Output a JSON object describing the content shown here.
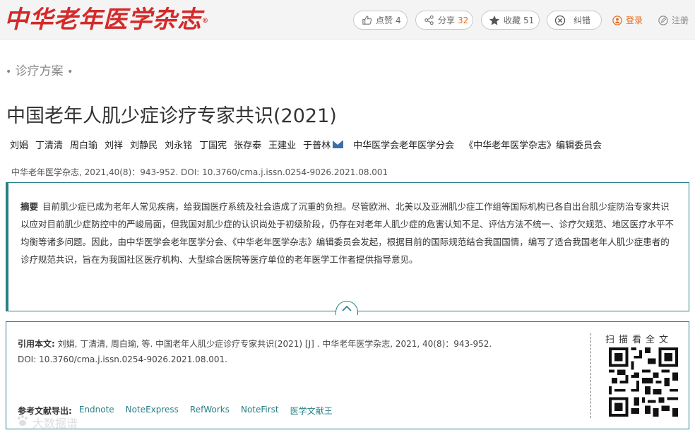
{
  "header": {
    "logo_text": "中华老年医学杂志",
    "logo_mark": "®",
    "like_label": "点赞",
    "like_count": "4",
    "share_label": "分享",
    "share_count": "32",
    "fav_label": "收藏",
    "fav_count": "51",
    "error_label": "纠错",
    "login_label": "登录",
    "register_label": "注册"
  },
  "article": {
    "section_dot": "•",
    "section": "诊疗方案",
    "title": "中国老年人肌少症诊疗专家共识(2021)",
    "authors": [
      "刘娟",
      "丁清清",
      "周白瑜",
      "刘祥",
      "刘静民",
      "刘永铭",
      "丁国宪",
      "张存泰",
      "王建业",
      "于普林"
    ],
    "orgs": [
      "中华医学会老年医学分会",
      "《中华老年医学杂志》编辑委员会"
    ],
    "citation_line": "中华老年医学杂志, 2021,40(8)：943-952. DOI: 10.3760/cma.j.issn.0254-9026.2021.08.001"
  },
  "abstract": {
    "label": "摘要",
    "text": "目前肌少症已成为老年人常见疾病，给我国医疗系统及社会造成了沉重的负担。尽管欧洲、北美以及亚洲肌少症工作组等国际机构已各自出台肌少症防治专家共识以应对目前肌少症防控中的严峻局面，但我国对肌少症的认识尚处于初级阶段，仍存在对老年人肌少症的危害认知不足、评估方法不统一、诊疗欠规范、地区医疗水平不均衡等诸多问题。因此，由中华医学会老年医学分会、《中华老年医学杂志》编辑委员会发起，根据目前的国际规范结合我国国情，编写了适合我国老年人肌少症患者的诊疗规范共识，旨在为我国社区医疗机构、大型综合医院等医疗单位的老年医学工作者提供指导意见。"
  },
  "cite_box": {
    "label": "引用本文:",
    "text": "刘娟, 丁清清, 周白瑜, 等. 中国老年人肌少症诊疗专家共识(2021) [J] . 中华老年医学杂志, 2021, 40(8)：943-952.",
    "doi": "DOI: 10.3760/cma.j.issn.0254-9026.2021.08.001.",
    "export_label": "参考文献导出:",
    "export_links": [
      "Endnote",
      "NoteExpress",
      "RefWorks",
      "NoteFirst",
      "医学文献王"
    ],
    "scan_label": "扫描看全文"
  },
  "watermark": "大数据谱",
  "colors": {
    "brand_red": "#d42a2a",
    "accent_teal": "#2a7f86",
    "count_orange": "#e66a1e"
  }
}
